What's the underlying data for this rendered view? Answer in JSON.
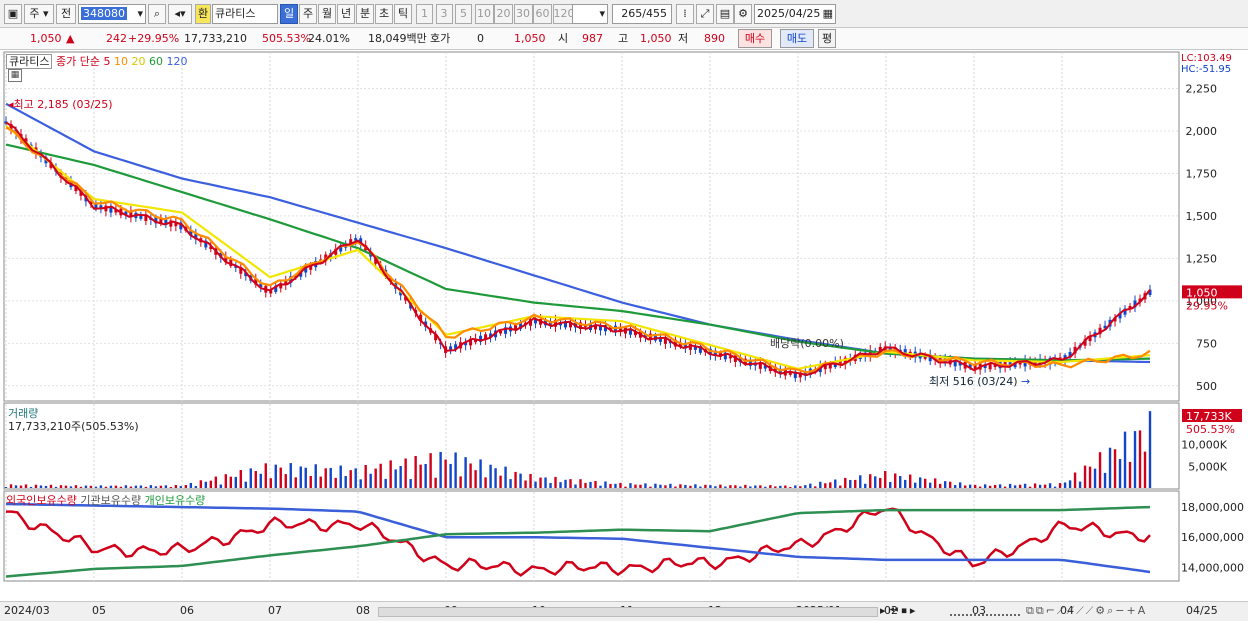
{
  "toolbar": {
    "code": "348080",
    "market_tab": "주",
    "prev_label": "전",
    "name_prefix": "환",
    "stock_name": "큐라티스",
    "period_tabs": [
      "일",
      "주",
      "월",
      "년",
      "분",
      "초",
      "틱"
    ],
    "active_period": "일",
    "minute_values": [
      "1",
      "3",
      "5",
      "10",
      "20",
      "30",
      "60",
      "120"
    ],
    "count_display": "265",
    "count_total": "/455",
    "date": "2025/04/25"
  },
  "quote": {
    "price": "1,050",
    "change": "242",
    "change_pct": "+29.95%",
    "volume": "17,733,210",
    "volume_pct": "505.53%",
    "turnover": "24.01%",
    "amount": "18,049백만",
    "hoga_label": "호가",
    "hoga_value": "0",
    "hoga_price": "1,050",
    "open_label": "시",
    "open_value": "987",
    "high_label": "고",
    "high_value": "1,050",
    "low_label": "저",
    "low_value": "890",
    "buy_label": "매수",
    "sell_label": "매도",
    "avg_label": "평"
  },
  "price_panel": {
    "legend_name": "큐라티스",
    "ma_label": "종가 단순",
    "ma_periods": [
      "5",
      "10",
      "20",
      "60",
      "120"
    ],
    "lc": "LC:103.49",
    "hc": "HC:-51.95",
    "high_note": "최고 2,185 (03/25)",
    "low_note": "최저 516 (03/24)",
    "dividend_note": "배당락(0.00%)",
    "current_price_tag": "1,050",
    "current_pct_tag": "29.95%",
    "yticks": [
      "2,250",
      "2,000",
      "1,750",
      "1,500",
      "1,250",
      "1,000",
      "750",
      "500"
    ]
  },
  "volume_panel": {
    "title": "거래량",
    "value_text": "17,733,210주(505.53%)",
    "tag_value": "17,733K",
    "tag_pct": "505.53%",
    "yticks": [
      "10,000K",
      "5,000K"
    ]
  },
  "holding_panel": {
    "legend": [
      "외국인보유수량",
      "기관보유수량",
      "개인보유수량"
    ],
    "yticks": [
      "18,000,000",
      "16,000,000",
      "14,000,000"
    ]
  },
  "footer": {
    "xticks": [
      "2024/03",
      "05",
      "06",
      "07",
      "08",
      "09",
      "10",
      "11",
      "12",
      "2025/01",
      "02",
      "03",
      "04"
    ],
    "end_date": "04/25"
  },
  "colors": {
    "up": "#d0021b",
    "down": "#1246c8",
    "ma5": "#d0021b",
    "ma10": "#ff8c00",
    "ma20": "#f2e600",
    "ma60": "#1f9a3a",
    "ma120": "#3c5fe0"
  },
  "chart_data": [
    {
      "type": "line",
      "title": "",
      "xlabel": "",
      "ylabel": "",
      "ylim": [
        440,
        2300
      ],
      "x": [
        "2024/03",
        "05",
        "06",
        "07",
        "08",
        "09",
        "10",
        "11",
        "12",
        "2025/01",
        "02",
        "03",
        "04",
        "04/25"
      ],
      "series": [
        {
          "name": "120",
          "values": [
            2160,
            1880,
            1720,
            1610,
            1460,
            1310,
            1150,
            990,
            860,
            770,
            690,
            660,
            650,
            640
          ]
        },
        {
          "name": "60",
          "values": [
            1920,
            1800,
            1640,
            1480,
            1310,
            1070,
            990,
            940,
            860,
            760,
            690,
            660,
            650,
            660
          ]
        },
        {
          "name": "20",
          "values": [
            2030,
            1600,
            1520,
            1140,
            1300,
            800,
            910,
            880,
            740,
            600,
            700,
            650,
            640,
            680
          ]
        },
        {
          "name": "10",
          "values": [
            2020,
            1590,
            1470,
            1080,
            1360,
            790,
            900,
            850,
            720,
            580,
            700,
            640,
            620,
            690
          ]
        },
        {
          "name": "5",
          "values": [
            2050,
            1560,
            1440,
            1050,
            1370,
            710,
            880,
            830,
            700,
            560,
            720,
            610,
            650,
            1050
          ]
        }
      ],
      "annotations": [
        "최고 2,185 (03/25)",
        "최저 516 (03/24)",
        "배당락(0.00%)"
      ]
    },
    {
      "type": "bar",
      "title": "거래량",
      "ylim": [
        0,
        18000
      ],
      "x": [
        "2024/03",
        "05",
        "06",
        "07",
        "08",
        "09",
        "10",
        "11",
        "12",
        "2025/01",
        "02",
        "03",
        "04",
        "04/25"
      ],
      "series": [
        {
          "name": "거래량",
          "values": [
            900,
            600,
            700,
            6000,
            5000,
            9000,
            3000,
            1200,
            800,
            600,
            4000,
            800,
            1200,
            17733
          ]
        }
      ]
    },
    {
      "type": "line",
      "title": "",
      "ylim": [
        13300000,
        18600000
      ],
      "x": [
        "2024/03",
        "05",
        "06",
        "07",
        "08",
        "09",
        "10",
        "11",
        "12",
        "2025/01",
        "02",
        "03",
        "04",
        "04/25"
      ],
      "series": [
        {
          "name": "외국인보유수량",
          "values": [
            17700000,
            15200000,
            15100000,
            16800000,
            16900000,
            14200000,
            13900000,
            14000000,
            14300000,
            15400000,
            17900000,
            14100000,
            16700000,
            16100000
          ]
        },
        {
          "name": "기관보유수량",
          "values": [
            18200000,
            18100000,
            18000000,
            17900000,
            17700000,
            16000000,
            16000000,
            15900000,
            15300000,
            14700000,
            14500000,
            14500000,
            14500000,
            13700000
          ]
        },
        {
          "name": "개인보유수량",
          "values": [
            13400000,
            13900000,
            14100000,
            14800000,
            15400000,
            16200000,
            16300000,
            16500000,
            16400000,
            17600000,
            17800000,
            17800000,
            17800000,
            18000000
          ]
        }
      ]
    }
  ]
}
